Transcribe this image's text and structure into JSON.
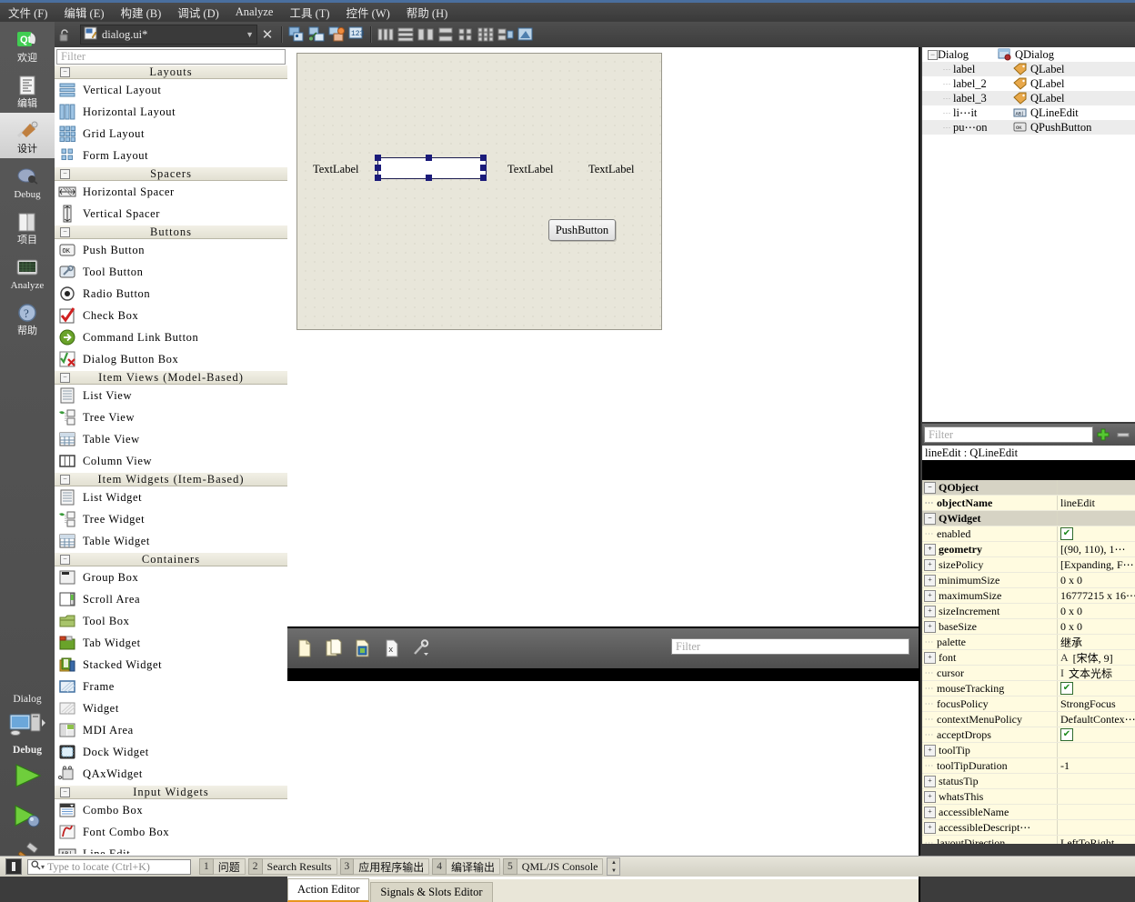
{
  "menu": {
    "items": [
      {
        "label": "文件 (F)"
      },
      {
        "label": "编辑 (E)"
      },
      {
        "label": "构建 (B)"
      },
      {
        "label": "调试 (D)"
      },
      {
        "label": "Analyze"
      },
      {
        "label": "工具 (T)"
      },
      {
        "label": "控件 (W)"
      },
      {
        "label": "帮助 (H)"
      }
    ]
  },
  "toolbar": {
    "filename": "dialog.ui*",
    "lock_icon": "unlocked-padlock-icon",
    "file_icon": "designer-file-icon",
    "dropdown_icon": "chevron-down-icon",
    "close_icon": "close-icon",
    "buttons": [
      {
        "name": "edit-widgets-icon",
        "title": "Edit Widgets"
      },
      {
        "name": "edit-signals-slots-icon",
        "title": "Edit Signals/Slots"
      },
      {
        "name": "edit-buddies-icon",
        "title": "Edit Buddies"
      },
      {
        "name": "edit-tab-order-icon",
        "title": "Edit Tab Order"
      },
      {
        "name": "layout-horizontally-icon",
        "title": "Lay Out Horizontally"
      },
      {
        "name": "layout-vertically-icon",
        "title": "Lay Out Vertically"
      },
      {
        "name": "layout-splitter-horizontal-icon",
        "title": "Lay Out Horizontally in Splitter"
      },
      {
        "name": "layout-splitter-vertical-icon",
        "title": "Lay Out Vertically in Splitter"
      },
      {
        "name": "layout-form-icon",
        "title": "Lay Out in a Form Layout"
      },
      {
        "name": "layout-grid-icon",
        "title": "Lay Out in a Grid"
      },
      {
        "name": "break-layout-icon",
        "title": "Break Layout"
      },
      {
        "name": "adjust-size-icon",
        "title": "Adjust Size"
      }
    ]
  },
  "modebar": {
    "items": [
      {
        "label": "欢迎",
        "icon": "qt-logo-icon",
        "selected": false
      },
      {
        "label": "编辑",
        "icon": "edit-document-icon",
        "selected": false
      },
      {
        "label": "设计",
        "icon": "design-brush-icon",
        "selected": true
      },
      {
        "label": "Debug",
        "icon": "debug-bug-icon",
        "selected": false
      },
      {
        "label": "项目",
        "icon": "projects-folder-icon",
        "selected": false
      },
      {
        "label": "Analyze",
        "icon": "analyze-scope-icon",
        "selected": false
      },
      {
        "label": "帮助",
        "icon": "help-question-icon",
        "selected": false
      }
    ],
    "run_config": {
      "target": "Dialog",
      "kit_icon": "desktop-computer-icon",
      "build_config": "Debug",
      "run_icon": "run-play-icon",
      "debug_icon": "start-debugging-icon",
      "build_icon": "build-hammer-icon"
    }
  },
  "widgetbox": {
    "filter_placeholder": "Filter",
    "categories": [
      {
        "title": "Layouts",
        "collapse_glyph": "−",
        "items": [
          {
            "label": "Vertical Layout",
            "icon": "vertical-layout-icon"
          },
          {
            "label": "Horizontal Layout",
            "icon": "horizontal-layout-icon"
          },
          {
            "label": "Grid Layout",
            "icon": "grid-layout-icon"
          },
          {
            "label": "Form Layout",
            "icon": "form-layout-icon"
          }
        ]
      },
      {
        "title": "Spacers",
        "collapse_glyph": "−",
        "items": [
          {
            "label": "Horizontal Spacer",
            "icon": "horizontal-spacer-icon"
          },
          {
            "label": "Vertical Spacer",
            "icon": "vertical-spacer-icon"
          }
        ]
      },
      {
        "title": "Buttons",
        "collapse_glyph": "−",
        "items": [
          {
            "label": "Push Button",
            "icon": "push-button-icon"
          },
          {
            "label": "Tool Button",
            "icon": "tool-button-icon"
          },
          {
            "label": "Radio Button",
            "icon": "radio-button-icon"
          },
          {
            "label": "Check Box",
            "icon": "check-box-icon"
          },
          {
            "label": "Command Link Button",
            "icon": "command-link-button-icon"
          },
          {
            "label": "Dialog Button Box",
            "icon": "dialog-button-box-icon"
          }
        ]
      },
      {
        "title": "Item Views (Model-Based)",
        "collapse_glyph": "−",
        "items": [
          {
            "label": "List View",
            "icon": "list-view-icon"
          },
          {
            "label": "Tree View",
            "icon": "tree-view-icon"
          },
          {
            "label": "Table View",
            "icon": "table-view-icon"
          },
          {
            "label": "Column View",
            "icon": "column-view-icon"
          }
        ]
      },
      {
        "title": "Item Widgets (Item-Based)",
        "collapse_glyph": "−",
        "items": [
          {
            "label": "List Widget",
            "icon": "list-widget-icon"
          },
          {
            "label": "Tree Widget",
            "icon": "tree-widget-icon"
          },
          {
            "label": "Table Widget",
            "icon": "table-widget-icon"
          }
        ]
      },
      {
        "title": "Containers",
        "collapse_glyph": "−",
        "items": [
          {
            "label": "Group Box",
            "icon": "group-box-icon"
          },
          {
            "label": "Scroll Area",
            "icon": "scroll-area-icon"
          },
          {
            "label": "Tool Box",
            "icon": "tool-box-icon"
          },
          {
            "label": "Tab Widget",
            "icon": "tab-widget-icon"
          },
          {
            "label": "Stacked Widget",
            "icon": "stacked-widget-icon"
          },
          {
            "label": "Frame",
            "icon": "frame-icon"
          },
          {
            "label": "Widget",
            "icon": "widget-icon"
          },
          {
            "label": "MDI Area",
            "icon": "mdi-area-icon"
          },
          {
            "label": "Dock Widget",
            "icon": "dock-widget-icon"
          },
          {
            "label": "QAxWidget",
            "icon": "qaxwidget-icon"
          }
        ]
      },
      {
        "title": "Input Widgets",
        "collapse_glyph": "−",
        "items": [
          {
            "label": "Combo Box",
            "icon": "combo-box-icon"
          },
          {
            "label": "Font Combo Box",
            "icon": "font-combo-box-icon"
          },
          {
            "label": "Line Edit",
            "icon": "line-edit-icon"
          }
        ]
      }
    ]
  },
  "form": {
    "labels": [
      {
        "text": "TextLabel"
      },
      {
        "text": "TextLabel"
      },
      {
        "text": "TextLabel"
      }
    ],
    "pushbutton": {
      "text": "PushButton"
    },
    "lineedit": {
      "selected": true,
      "handles": 8
    }
  },
  "action_editor": {
    "toolbar_icons": [
      {
        "name": "new-action-icon"
      },
      {
        "name": "copy-action-icon"
      },
      {
        "name": "paste-action-icon"
      },
      {
        "name": "delete-action-icon"
      },
      {
        "name": "configure-icon"
      }
    ],
    "filter_placeholder": "Filter",
    "tabs": [
      {
        "label": "Action Editor",
        "active": true
      },
      {
        "label": "Signals & Slots Editor",
        "active": false
      }
    ]
  },
  "object_inspector": {
    "rows": [
      {
        "name": "Dialog",
        "class": "QDialog",
        "icon": "dialog-icon",
        "depth": 0,
        "expander": "−"
      },
      {
        "name": "label",
        "class": "QLabel",
        "icon": "label-icon",
        "depth": 1,
        "expander": ""
      },
      {
        "name": "label_2",
        "class": "QLabel",
        "icon": "label-icon",
        "depth": 1,
        "expander": ""
      },
      {
        "name": "label_3",
        "class": "QLabel",
        "icon": "label-icon",
        "depth": 1,
        "expander": ""
      },
      {
        "name": "li⋯it",
        "class": "QLineEdit",
        "icon": "lineedit-icon",
        "depth": 1,
        "expander": ""
      },
      {
        "name": "pu⋯on",
        "class": "QPushButton",
        "icon": "pushbutton-icon",
        "depth": 1,
        "expander": ""
      }
    ]
  },
  "property_editor": {
    "filter_placeholder": "Filter",
    "add_icon": "plus-icon",
    "remove_icon": "minus-icon",
    "header": "lineEdit : QLineEdit",
    "rows": [
      {
        "name": "QObject",
        "value": "",
        "group": true,
        "expander": "−"
      },
      {
        "name": "objectName",
        "value": "lineEdit",
        "bold": true,
        "expander": "dots"
      },
      {
        "name": "QWidget",
        "value": "",
        "group": true,
        "expander": "−"
      },
      {
        "name": "enabled",
        "value": "",
        "checkbox": true,
        "expander": "dots"
      },
      {
        "name": "geometry",
        "value": "[(90, 110), 1⋯",
        "bold": true,
        "expander": "+"
      },
      {
        "name": "sizePolicy",
        "value": "[Expanding, F⋯",
        "expander": "+"
      },
      {
        "name": "minimumSize",
        "value": "0 x 0",
        "expander": "+"
      },
      {
        "name": "maximumSize",
        "value": "16777215 x 16⋯",
        "expander": "+"
      },
      {
        "name": "sizeIncrement",
        "value": "0 x 0",
        "expander": "+"
      },
      {
        "name": "baseSize",
        "value": "0 x 0",
        "expander": "+"
      },
      {
        "name": "palette",
        "value": "继承",
        "expander": "dots"
      },
      {
        "name": "font",
        "value": "[宋体, 9]",
        "valueIcon": "font-A-icon",
        "expander": "+"
      },
      {
        "name": "cursor",
        "value": "文本光标",
        "valueIcon": "ibeam-cursor-icon",
        "expander": "dots"
      },
      {
        "name": "mouseTracking",
        "value": "",
        "checkbox": true,
        "expander": "dots"
      },
      {
        "name": "focusPolicy",
        "value": "StrongFocus",
        "expander": "dots"
      },
      {
        "name": "contextMenuPolicy",
        "value": "DefaultContex⋯",
        "expander": "dots"
      },
      {
        "name": "acceptDrops",
        "value": "",
        "checkbox": true,
        "expander": "dots"
      },
      {
        "name": "toolTip",
        "value": "",
        "expander": "+"
      },
      {
        "name": "toolTipDuration",
        "value": "-1",
        "expander": "dots"
      },
      {
        "name": "statusTip",
        "value": "",
        "expander": "+"
      },
      {
        "name": "whatsThis",
        "value": "",
        "expander": "+"
      },
      {
        "name": "accessibleName",
        "value": "",
        "expander": "+"
      },
      {
        "name": "accessibleDescript⋯",
        "value": "",
        "expander": "+"
      },
      {
        "name": "layoutDirection",
        "value": "LeftToRight",
        "expander": "dots"
      }
    ]
  },
  "statusbar": {
    "sidebar_toggle_icon": "sidebar-toggle-icon",
    "locate_icon": "search-icon",
    "locate_placeholder": "Type to locate (Ctrl+K)",
    "panels": [
      {
        "num": "1",
        "label": "问题"
      },
      {
        "num": "2",
        "label": "Search Results"
      },
      {
        "num": "3",
        "label": "应用程序输出"
      },
      {
        "num": "4",
        "label": "编译输出"
      },
      {
        "num": "5",
        "label": "QML/JS Console"
      }
    ],
    "spin_up": "▲",
    "spin_down": "▼"
  },
  "colors": {
    "accent_orange": "#e8961e",
    "selection_blue": "#1b1b7a",
    "form_bg": "#e8e6da",
    "property_value_bg": "#fffbe0",
    "chrome_dark": "#4a4a4a"
  }
}
